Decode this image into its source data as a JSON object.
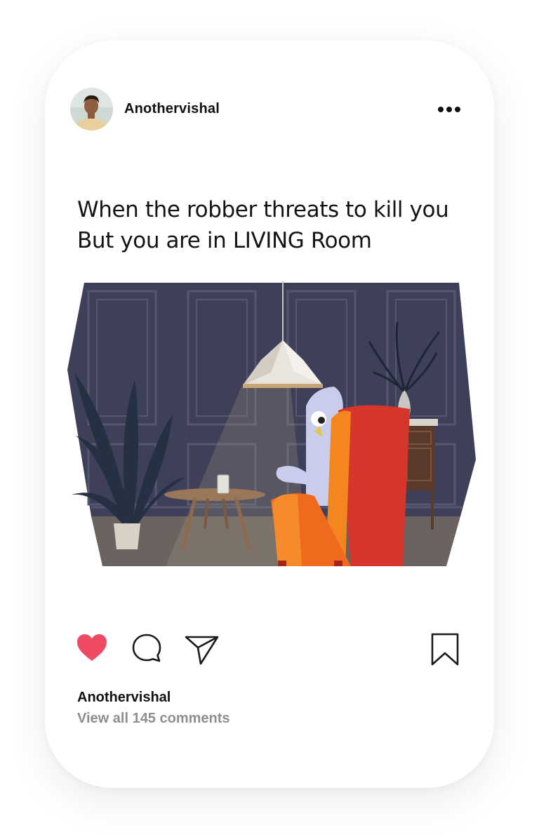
{
  "post": {
    "username": "Anothervishal",
    "more_icon": "ellipsis-horizontal-icon",
    "meme": {
      "caption_line1": "When the robber threats to kill you",
      "caption_line2": "But you are in LIVING Room"
    },
    "actions": {
      "like_icon": "heart-filled-icon",
      "comment_icon": "speech-bubble-icon",
      "share_icon": "paper-plane-icon",
      "bookmark_icon": "bookmark-icon",
      "liked": true
    },
    "footer": {
      "author": "Anothervishal",
      "view_comments": "View all 145 comments"
    }
  },
  "colors": {
    "like": "#ee4a63",
    "wall": "#3e3f58",
    "chair": "#f0562b"
  }
}
